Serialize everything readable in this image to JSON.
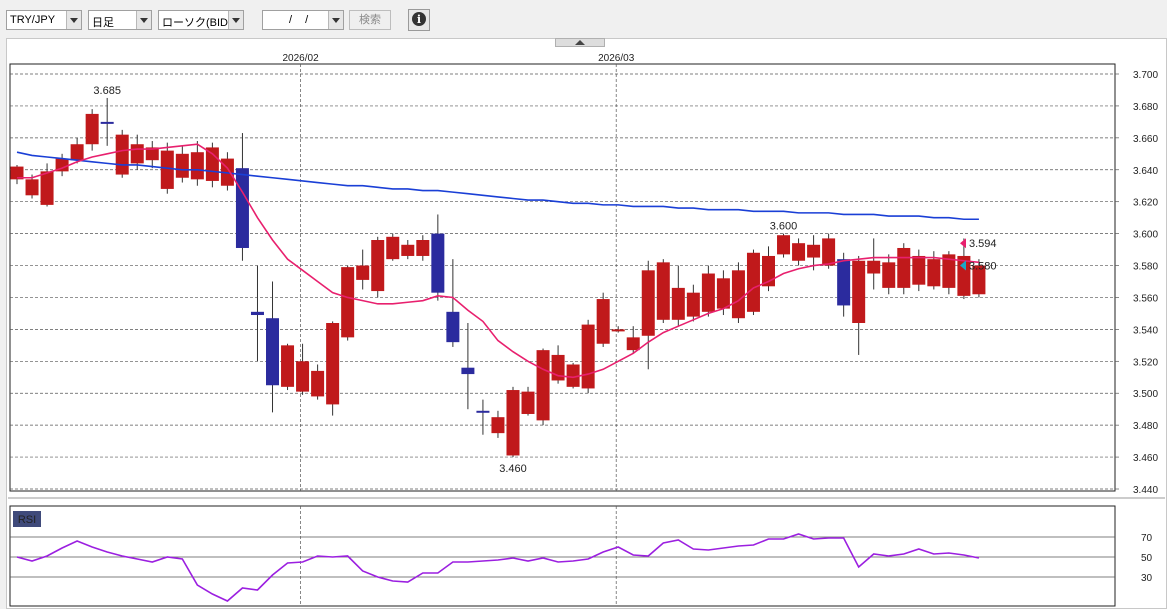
{
  "toolbar": {
    "pair": "TRY/JPY",
    "period": "日足",
    "chart_type": "ローソク(BID)",
    "date": "/ /",
    "search_label": "検索",
    "info_icon": "info-icon"
  },
  "colors": {
    "up": "#c0191b",
    "down": "#2b2b9e",
    "ma_short": "#e8206e",
    "ma_long": "#1a3fd6",
    "rsi": "#9b1fe0",
    "high_label": "#d4770a",
    "low_label": "#1aa01a"
  },
  "chart_data": [
    {
      "type": "candlestick",
      "x_labels": [
        "2026/02",
        "2026/03"
      ],
      "y_ticks": [
        "3.700",
        "3.680",
        "3.660",
        "3.640",
        "3.620",
        "3.600",
        "3.580",
        "3.560",
        "3.540",
        "3.520",
        "3.500",
        "3.480",
        "3.460",
        "3.440"
      ],
      "ylim": [
        3.44,
        3.7
      ],
      "grid": true,
      "candles": [
        [
          3.634,
          3.642,
          3.643,
          3.631
        ],
        [
          3.624,
          3.634,
          3.637,
          3.622
        ],
        [
          3.618,
          3.639,
          3.644,
          3.617
        ],
        [
          3.639,
          3.647,
          3.65,
          3.636
        ],
        [
          3.646,
          3.656,
          3.66,
          3.644
        ],
        [
          3.656,
          3.675,
          3.678,
          3.652
        ],
        [
          3.67,
          3.669,
          3.685,
          3.655
        ],
        [
          3.637,
          3.662,
          3.665,
          3.635
        ],
        [
          3.644,
          3.656,
          3.662,
          3.64
        ],
        [
          3.646,
          3.654,
          3.658,
          3.641
        ],
        [
          3.628,
          3.652,
          3.657,
          3.625
        ],
        [
          3.635,
          3.65,
          3.655,
          3.632
        ],
        [
          3.634,
          3.651,
          3.658,
          3.63
        ],
        [
          3.633,
          3.654,
          3.657,
          3.629
        ],
        [
          3.63,
          3.647,
          3.651,
          3.627
        ],
        [
          3.641,
          3.591,
          3.663,
          3.583
        ],
        [
          3.551,
          3.549,
          3.58,
          3.52
        ],
        [
          3.547,
          3.505,
          3.57,
          3.488
        ],
        [
          3.504,
          3.53,
          3.531,
          3.502
        ],
        [
          3.501,
          3.52,
          3.531,
          3.499
        ],
        [
          3.498,
          3.514,
          3.518,
          3.496
        ],
        [
          3.493,
          3.544,
          3.545,
          3.486
        ],
        [
          3.535,
          3.579,
          3.58,
          3.533
        ],
        [
          3.571,
          3.58,
          3.59,
          3.565
        ],
        [
          3.564,
          3.596,
          3.598,
          3.56
        ],
        [
          3.584,
          3.598,
          3.6,
          3.583
        ],
        [
          3.586,
          3.593,
          3.596,
          3.584
        ],
        [
          3.586,
          3.596,
          3.599,
          3.583
        ],
        [
          3.6,
          3.563,
          3.612,
          3.558
        ],
        [
          3.551,
          3.532,
          3.584,
          3.529
        ],
        [
          3.516,
          3.512,
          3.544,
          3.49
        ],
        [
          3.489,
          3.488,
          3.496,
          3.474
        ],
        [
          3.475,
          3.485,
          3.489,
          3.472
        ],
        [
          3.461,
          3.502,
          3.504,
          3.46
        ],
        [
          3.487,
          3.501,
          3.504,
          3.486
        ],
        [
          3.483,
          3.527,
          3.528,
          3.48
        ],
        [
          3.508,
          3.524,
          3.53,
          3.506
        ],
        [
          3.504,
          3.518,
          3.519,
          3.503
        ],
        [
          3.503,
          3.543,
          3.546,
          3.5
        ],
        [
          3.531,
          3.559,
          3.563,
          3.529
        ],
        [
          3.54,
          3.54,
          3.542,
          3.538
        ],
        [
          3.527,
          3.535,
          3.542,
          3.525
        ],
        [
          3.536,
          3.577,
          3.583,
          3.515
        ],
        [
          3.546,
          3.582,
          3.584,
          3.544
        ],
        [
          3.546,
          3.566,
          3.58,
          3.542
        ],
        [
          3.548,
          3.563,
          3.568,
          3.545
        ],
        [
          3.551,
          3.575,
          3.58,
          3.548
        ],
        [
          3.553,
          3.572,
          3.577,
          3.549
        ],
        [
          3.547,
          3.577,
          3.582,
          3.544
        ],
        [
          3.551,
          3.588,
          3.59,
          3.549
        ],
        [
          3.567,
          3.586,
          3.592,
          3.564
        ],
        [
          3.587,
          3.599,
          3.6,
          3.585
        ],
        [
          3.583,
          3.594,
          3.597,
          3.58
        ],
        [
          3.585,
          3.593,
          3.599,
          3.577
        ],
        [
          3.58,
          3.597,
          3.6,
          3.578
        ],
        [
          3.584,
          3.555,
          3.588,
          3.548
        ],
        [
          3.544,
          3.583,
          3.586,
          3.524
        ],
        [
          3.575,
          3.583,
          3.597,
          3.565
        ],
        [
          3.566,
          3.582,
          3.587,
          3.562
        ],
        [
          3.566,
          3.591,
          3.594,
          3.562
        ],
        [
          3.568,
          3.586,
          3.59,
          3.564
        ],
        [
          3.567,
          3.584,
          3.589,
          3.565
        ],
        [
          3.566,
          3.587,
          3.589,
          3.562
        ],
        [
          3.561,
          3.586,
          3.597,
          3.559
        ],
        [
          3.562,
          3.58,
          3.584,
          3.56
        ]
      ],
      "ma_short": [
        3.635,
        3.635,
        3.638,
        3.641,
        3.645,
        3.648,
        3.65,
        3.652,
        3.653,
        3.653,
        3.654,
        3.655,
        3.656,
        3.65,
        3.641,
        3.626,
        3.61,
        3.596,
        3.584,
        3.577,
        3.57,
        3.563,
        3.56,
        3.558,
        3.556,
        3.556,
        3.557,
        3.558,
        3.561,
        3.56,
        3.552,
        3.545,
        3.533,
        3.526,
        3.52,
        3.515,
        3.511,
        3.51,
        3.512,
        3.515,
        3.52,
        3.525,
        3.532,
        3.538,
        3.542,
        3.546,
        3.55,
        3.553,
        3.558,
        3.566,
        3.57,
        3.575,
        3.578,
        3.58,
        3.581,
        3.583,
        3.584,
        3.585,
        3.585,
        3.585,
        3.585,
        3.585,
        3.584,
        3.583,
        3.582
      ],
      "ma_long": [
        3.651,
        3.649,
        3.648,
        3.647,
        3.646,
        3.645,
        3.644,
        3.643,
        3.643,
        3.642,
        3.641,
        3.64,
        3.64,
        3.639,
        3.638,
        3.637,
        3.636,
        3.635,
        3.634,
        3.633,
        3.632,
        3.631,
        3.63,
        3.63,
        3.629,
        3.628,
        3.628,
        3.627,
        3.627,
        3.626,
        3.625,
        3.624,
        3.623,
        3.622,
        3.621,
        3.621,
        3.62,
        3.619,
        3.619,
        3.618,
        3.618,
        3.617,
        3.617,
        3.617,
        3.616,
        3.616,
        3.615,
        3.615,
        3.615,
        3.614,
        3.614,
        3.614,
        3.613,
        3.613,
        3.613,
        3.612,
        3.612,
        3.612,
        3.611,
        3.611,
        3.611,
        3.61,
        3.61,
        3.609,
        3.609
      ],
      "annotations": [
        {
          "label": "3.685",
          "value": 3.685,
          "index": 6,
          "kind": "high"
        },
        {
          "label": "3.460",
          "value": 3.46,
          "index": 33,
          "kind": "low"
        },
        {
          "label": "3.600",
          "value": 3.6,
          "index": 51,
          "kind": "high"
        }
      ],
      "markers": [
        {
          "label": "3.594",
          "value": 3.594,
          "color": "#e8206e"
        },
        {
          "label": "3.580",
          "value": 3.58,
          "color": "#1aa8c8"
        }
      ]
    },
    {
      "type": "line",
      "title": "RSI",
      "y_ticks": [
        "70",
        "50",
        "30"
      ],
      "ylim": [
        0,
        100
      ],
      "values": [
        50,
        46,
        51,
        59,
        66,
        60,
        55,
        51,
        48,
        45,
        50,
        48,
        22,
        13,
        6,
        19,
        17,
        32,
        44,
        45,
        51,
        50,
        51,
        36,
        30,
        26,
        25,
        34,
        34,
        45,
        45,
        46,
        47,
        49,
        46,
        49,
        45,
        46,
        48,
        55,
        60,
        52,
        51,
        64,
        67,
        58,
        57,
        59,
        61,
        62,
        68,
        68,
        73,
        68,
        69,
        69,
        40,
        53,
        51,
        53,
        58,
        53,
        54,
        52,
        49
      ]
    }
  ]
}
